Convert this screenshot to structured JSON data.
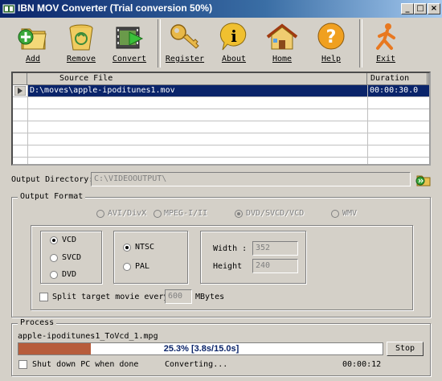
{
  "window": {
    "title": "IBN MOV Converter (Trial conversion 50%)",
    "minimize": "_",
    "maximize": "□",
    "close": "×"
  },
  "toolbar": [
    {
      "label": "Add",
      "icon": "add-folder-icon"
    },
    {
      "label": "Remove",
      "icon": "trash-icon"
    },
    {
      "label": "Convert",
      "icon": "film-convert-icon"
    },
    {
      "label": "Register",
      "icon": "key-icon"
    },
    {
      "label": "About",
      "icon": "info-icon"
    },
    {
      "label": "Home",
      "icon": "home-icon"
    },
    {
      "label": "Help",
      "icon": "help-icon"
    },
    {
      "label": "Exit",
      "icon": "running-man-icon"
    }
  ],
  "filelist": {
    "columns": [
      "Source File",
      "Duration"
    ],
    "rows": [
      {
        "file": "D:\\moves\\apple-ipoditunes1.mov",
        "duration": "00:00:30.0"
      }
    ]
  },
  "output_dir": {
    "label": "Output Directory:",
    "value": "C:\\VIDEOOUTPUT\\"
  },
  "output_format": {
    "title": "Output Format",
    "formats": [
      {
        "label": "AVI/DivX",
        "selected": false
      },
      {
        "label": "MPEG-I/II",
        "selected": false
      },
      {
        "label": "DVD/SVCD/VCD",
        "selected": true
      },
      {
        "label": "WMV",
        "selected": false
      }
    ],
    "disc_types": [
      {
        "label": "VCD",
        "selected": true
      },
      {
        "label": "SVCD",
        "selected": false
      },
      {
        "label": "DVD",
        "selected": false
      }
    ],
    "standards": [
      {
        "label": "NTSC",
        "selected": true
      },
      {
        "label": "PAL",
        "selected": false
      }
    ],
    "width_label": "Width :",
    "width_value": "352",
    "height_label": "Height",
    "height_value": "240",
    "split_label": "Split target movie every",
    "split_value": "600",
    "split_unit": "MBytes"
  },
  "process": {
    "title": "Process",
    "current_file": "apple-ipoditunes1_ToVcd_1.mpg",
    "progress_text": "25.3% [3.8s/15.0s]",
    "progress_percent": 25.3,
    "stop_label": "Stop",
    "shutdown_label": "Shut down PC when done",
    "status": "Converting...",
    "elapsed": "00:00:12"
  },
  "colors": {
    "titlebar": "#0a246a",
    "progress_fill": "#b75c3b",
    "selection": "#0a246a"
  }
}
